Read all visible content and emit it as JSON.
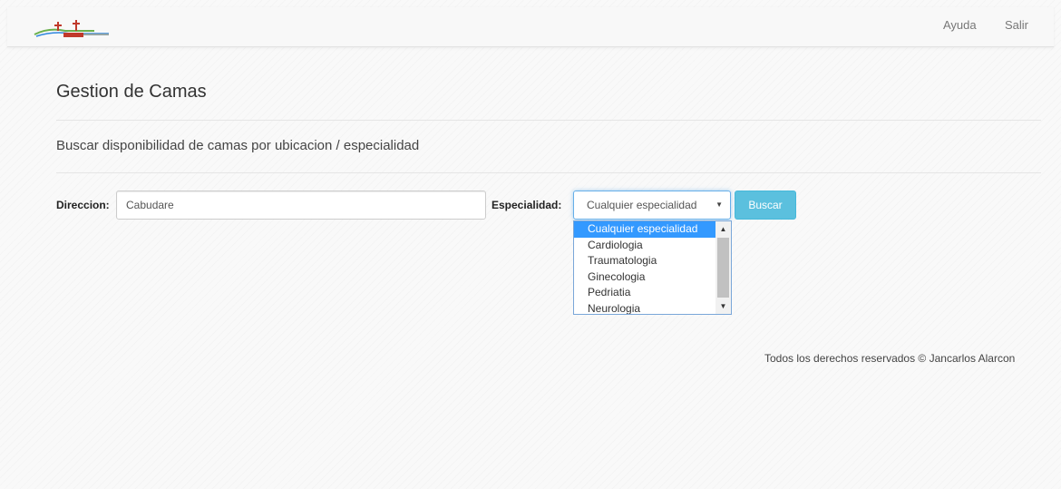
{
  "nav": {
    "ayuda": "Ayuda",
    "salir": "Salir"
  },
  "page": {
    "title": "Gestion de Camas",
    "subtitle": "Buscar disponibilidad de camas por ubicacion / especialidad"
  },
  "form": {
    "direccion_label": "Direccion:",
    "direccion_value": "Cabudare",
    "especialidad_label": "Especialidad:",
    "especialidad_selected": "Cualquier especialidad",
    "buscar_label": "Buscar",
    "options": [
      "Cualquier especialidad",
      "Cardiologia",
      "Traumatologia",
      "Ginecologia",
      "Pedriatia",
      "Neurologia"
    ]
  },
  "footer": {
    "text": "Todos los derechos reservados © Jancarlos Alarcon"
  },
  "colors": {
    "accent": "#5bc0de",
    "selection": "#3399ff",
    "focus": "#66afe9"
  }
}
